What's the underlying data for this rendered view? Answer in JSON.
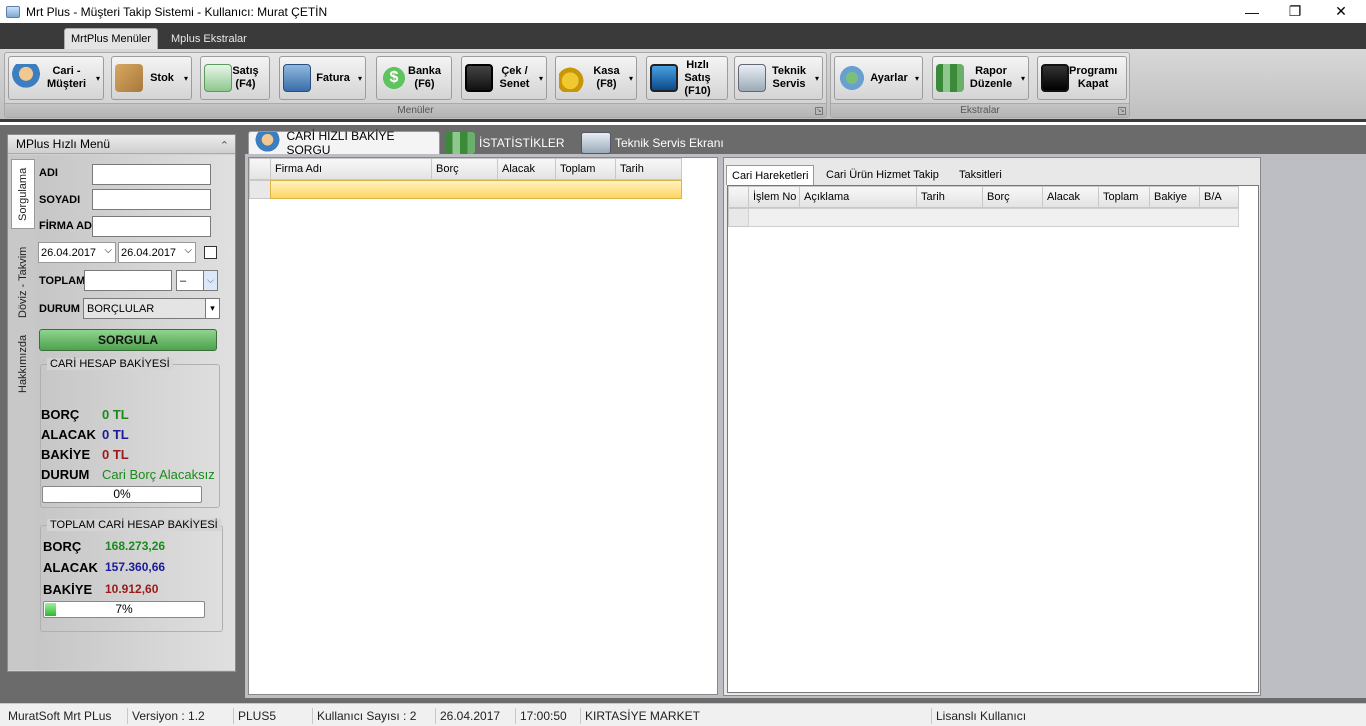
{
  "window": {
    "title": "Mrt Plus - Müşteri Takip Sistemi - Kullanıcı: Murat ÇETİN",
    "minimize": "—",
    "restore": "❐",
    "close": "✕"
  },
  "ribbon": {
    "tabs": [
      "MrtPlus Menüler",
      "Mplus Ekstralar"
    ],
    "groups": {
      "menuler": "Menüler",
      "ekstralar": "Ekstralar"
    },
    "buttons": [
      {
        "label": "Cari -\nMüşteri",
        "icon": "customer-icon",
        "arrow": "▾"
      },
      {
        "label": "Stok",
        "icon": "stock-boxes-icon",
        "arrow": "▾"
      },
      {
        "label": "Satış\n(F4)",
        "icon": "sales-icon",
        "arrow": ""
      },
      {
        "label": "Fatura",
        "icon": "invoice-printer-icon",
        "arrow": "▾"
      },
      {
        "label": "Banka\n(F6)",
        "icon": "bank-dollar-icon",
        "arrow": ""
      },
      {
        "label": "Çek /\nSenet",
        "icon": "floppy-save-icon",
        "arrow": "▾"
      },
      {
        "label": "Kasa\n(F8)",
        "icon": "coins-icon",
        "arrow": "▾"
      },
      {
        "label": "Hızlı\nSatış\n(F10)",
        "icon": "monitor-icon",
        "arrow": ""
      },
      {
        "label": "Teknik\nServis",
        "icon": "computer-service-icon",
        "arrow": "▾"
      },
      {
        "label": "Ayarlar",
        "icon": "settings-icon",
        "arrow": "▾"
      },
      {
        "label": "Rapor\nDüzenle",
        "icon": "report-chart-icon",
        "arrow": "▾"
      },
      {
        "label": "Programı\nKapat",
        "icon": "exit-monitor-icon",
        "arrow": ""
      }
    ]
  },
  "quickmenu": {
    "title": "MPlus Hızlı Menü",
    "collapse": "⌃",
    "vtabs": [
      "Sorgulama",
      "Döviz - Takvim",
      "Hakkımızda"
    ],
    "labels": {
      "adi": "ADI",
      "soyadi": "SOYADI",
      "firma": "FİRMA ADI",
      "toplam": "TOPLAM",
      "durum": "DURUM"
    },
    "date_from": "26.04.2017",
    "date_to": "26.04.2017",
    "date_arrow": "⌵",
    "toplam_op": "–",
    "toplam_arrow": "⌵",
    "durum_value": "BORÇLULAR",
    "durum_arrow": "▾",
    "sorgula": "SORGULA",
    "cari": {
      "legend": "CARİ HESAP BAKİYESİ",
      "borc_label": "BORÇ",
      "borc_value": "0 TL",
      "alacak_label": "ALACAK",
      "alacak_value": "0 TL",
      "bakiye_label": "BAKİYE",
      "bakiye_value": "0 TL",
      "durum_label": "DURUM",
      "durum_value": "Cari Borç Alacaksız",
      "progress_text": "0%",
      "progress": 0
    },
    "toplam_cari": {
      "legend": "TOPLAM CARİ HESAP BAKİYESİ",
      "borc_label": "BORÇ",
      "borc_value": "168.273,26",
      "alacak_label": "ALACAK",
      "alacak_value": "157.360,66",
      "bakiye_label": "BAKİYE",
      "bakiye_value": "10.912,60",
      "progress_text": "7%",
      "progress": 0.07
    }
  },
  "content_tabs": [
    {
      "label": "CARİ HIZLI BAKİYE SORGU",
      "icon": "user-query-icon"
    },
    {
      "label": "İSTATİSTİKLER",
      "icon": "statistics-icon"
    },
    {
      "label": "Teknik Servis Ekranı",
      "icon": "service-monitor-icon"
    }
  ],
  "left_grid": {
    "columns": [
      "Firma Adı",
      "Borç",
      "Alacak",
      "Toplam",
      "Tarih"
    ]
  },
  "right_panel": {
    "tabs": [
      "Cari Hareketleri",
      "Cari Ürün Hizmet Takip",
      "Taksitleri"
    ],
    "columns": [
      "İşlem No",
      "Açıklama",
      "Tarih",
      "Borç",
      "Alacak",
      "Toplam",
      "Bakiye",
      "B/A"
    ]
  },
  "statusbar": [
    "MuratSoft Mrt PLus",
    "Versiyon : 1.2",
    "PLUS5",
    "Kullanıcı Sayısı : 2",
    "26.04.2017",
    "17:00:50",
    "KIRTASİYE MARKET",
    "Lisanslı Kullanıcı"
  ],
  "colors": {
    "green": "#1a8a1a",
    "blue": "#1a1a9a",
    "red": "#9a1a1a"
  }
}
